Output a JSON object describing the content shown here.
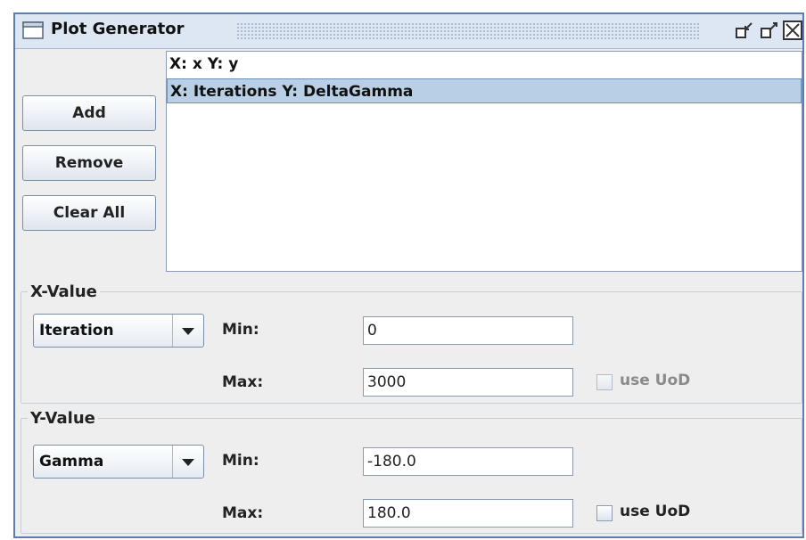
{
  "window": {
    "title": "Plot Generator"
  },
  "buttons": {
    "add": "Add",
    "remove": "Remove",
    "clear_all": "Clear All"
  },
  "plot_list": {
    "items": [
      {
        "label": "X: x Y: y",
        "selected": false
      },
      {
        "label": "X: Iterations Y: DeltaGamma",
        "selected": true
      }
    ]
  },
  "x_value": {
    "legend": "X-Value",
    "selected": "Iteration",
    "min_label": "Min:",
    "min_value": "0",
    "max_label": "Max:",
    "max_value": "3000",
    "use_uod_label": "use UoD",
    "use_uod_checked": false,
    "use_uod_enabled": false
  },
  "y_value": {
    "legend": "Y-Value",
    "selected": "Gamma",
    "min_label": "Min:",
    "min_value": "-180.0",
    "max_label": "Max:",
    "max_value": "180.0",
    "use_uod_label": "use UoD",
    "use_uod_checked": false,
    "use_uod_enabled": true
  },
  "colors": {
    "selection": "#b8cfe5",
    "window_border": "#5b7db0",
    "disabled_text": "#8a8a8a"
  }
}
